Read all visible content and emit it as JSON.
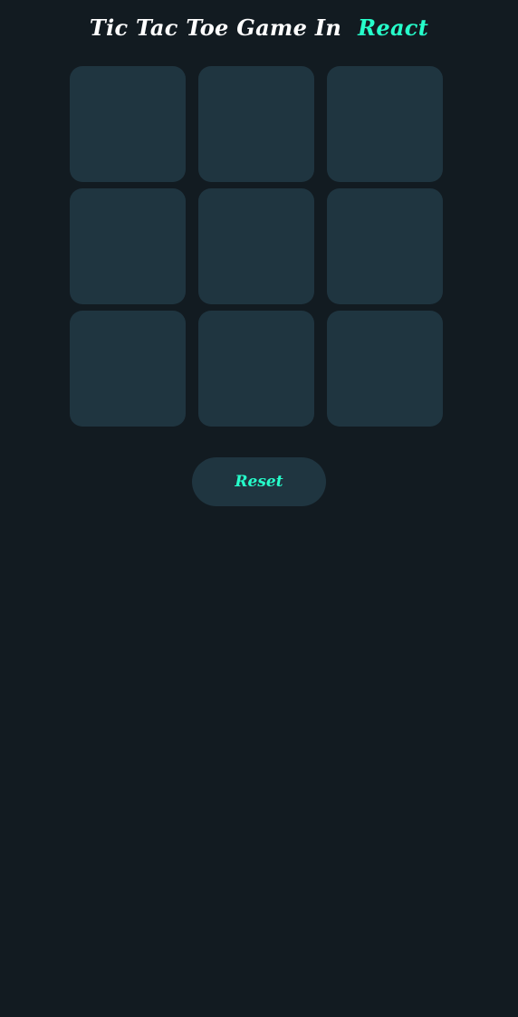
{
  "header": {
    "title_prefix": "Tic Tac Toe Game In",
    "title_accent": "React"
  },
  "board": {
    "cells": [
      "",
      "",
      "",
      "",
      "",
      "",
      "",
      "",
      ""
    ]
  },
  "controls": {
    "reset_label": "Reset"
  },
  "colors": {
    "background": "#121b21",
    "cell": "#1f3540",
    "accent": "#26ffcb",
    "title": "#ffffff"
  }
}
